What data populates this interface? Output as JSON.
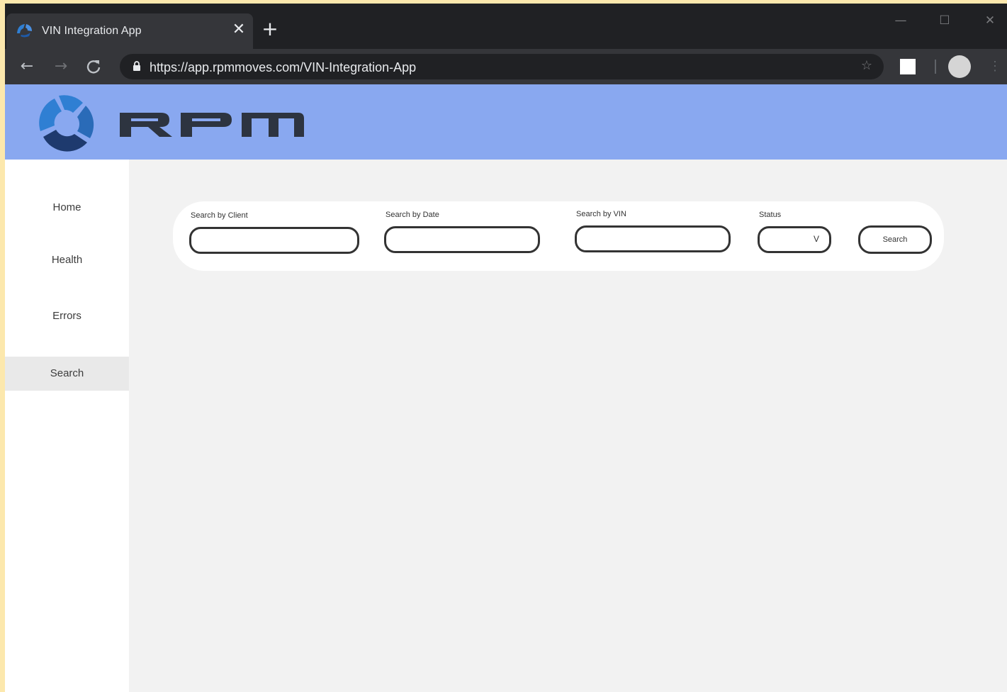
{
  "browser": {
    "tab_title": "VIN Integration App",
    "tab_close": "✕",
    "new_tab": "+",
    "url": "https://app.rpmmoves.com/VIN-Integration-App",
    "icons": {
      "back": "←",
      "forward": "→",
      "reload": "C",
      "star": "☆",
      "minimize": "—",
      "maximize": "☐",
      "close": "✕",
      "menu": "⋮"
    }
  },
  "header": {
    "brand": "RPM",
    "colors": {
      "header_bg": "#89a8f0",
      "logo_light": "#2f7fd3",
      "logo_dark": "#1e3a6e",
      "wordmark": "#2d3440"
    }
  },
  "sidebar": {
    "items": [
      {
        "label": "Home"
      },
      {
        "label": "Health"
      },
      {
        "label": "Errors"
      },
      {
        "label": "Search",
        "active": true
      }
    ]
  },
  "search": {
    "client_label": "Search by Client",
    "client_value": "",
    "date_label": "Search by Date",
    "date_value": "",
    "vin_label": "Search by VIN",
    "vin_value": "",
    "status_label": "Status",
    "status_value": "",
    "status_arrow": "V",
    "search_button": "Search"
  }
}
